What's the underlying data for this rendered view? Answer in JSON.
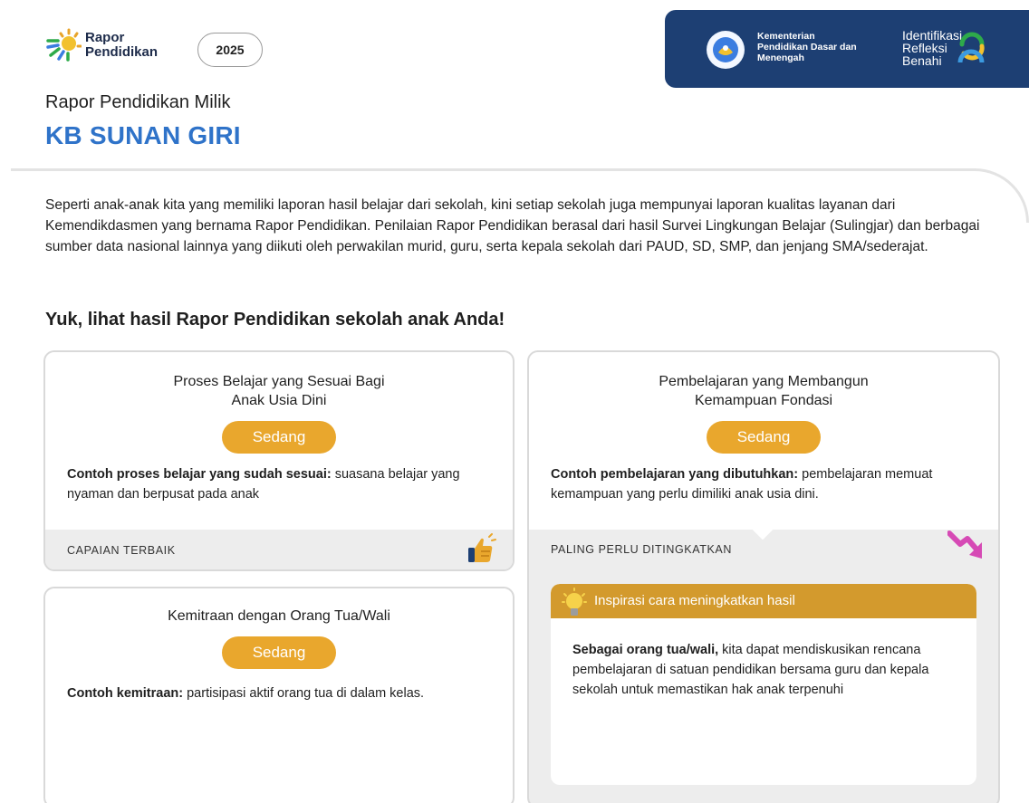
{
  "header": {
    "brand_line1": "Rapor",
    "brand_line2": "Pendidikan",
    "year": "2025",
    "ministry_line1": "Kementerian",
    "ministry_line2": "Pendidikan Dasar dan",
    "ministry_line3": "Menengah",
    "irb_line1": "Identifikasi",
    "irb_line2": "Refleksi",
    "irb_line3": "Benahi"
  },
  "page": {
    "subtitle": "Rapor Pendidikan Milik",
    "school_name": "KB SUNAN GIRI",
    "intro": "Seperti anak-anak kita yang memiliki laporan hasil belajar dari sekolah, kini setiap sekolah juga mempunyai laporan kualitas layanan dari Kemendikdasmen yang bernama Rapor Pendidikan. Penilaian Rapor Pendidikan berasal dari hasil Survei Lingkungan Belajar (Sulingjar) dan berbagai sumber data nasional lainnya yang diikuti oleh perwakilan murid, guru, serta kepala sekolah dari PAUD, SD, SMP, dan jenjang SMA/sederajat.",
    "section_title": "Yuk, lihat hasil Rapor Pendidikan sekolah anak Anda!"
  },
  "cards": [
    {
      "title_line1": "Proses Belajar yang Sesuai Bagi",
      "title_line2": "Anak Usia Dini",
      "level": "Sedang",
      "desc_bold": "Contoh proses belajar yang sudah sesuai:",
      "desc_text": " suasana belajar yang nyaman dan berpusat pada anak",
      "footer": "CAPAIAN TERBAIK"
    },
    {
      "title_line1": "Kemitraan dengan Orang Tua/Wali",
      "level": "Sedang",
      "desc_bold": "Contoh kemitraan:",
      "desc_text": " partisipasi aktif orang tua di dalam kelas."
    },
    {
      "title_line1": "Pembelajaran yang Membangun",
      "title_line2": "Kemampuan Fondasi",
      "level": "Sedang",
      "desc_bold": "Contoh pembelajaran yang dibutuhkan:",
      "desc_text": " pembelajaran memuat kemampuan yang perlu dimiliki anak usia dini.",
      "footer": "PALING PERLU DITINGKATKAN"
    }
  ],
  "inspiration": {
    "heading": "Inspirasi cara meningkatkan hasil",
    "body_bold": "Sebagai orang tua/wali,",
    "body_text": " kita dapat mendiskusikan rencana pembelajaran di satuan pendidikan bersama guru dan kepala sekolah untuk memastikan hak anak terpenuhi"
  },
  "colors": {
    "accent_blue": "#2f73c9",
    "banner_navy": "#1d3f73",
    "pill_orange": "#e9a72d",
    "inspiration_orange": "#d39a2d",
    "footer_gray": "#ededed"
  },
  "icons": [
    "rapor-pendidikan-logo-icon",
    "tut-wuri-handayani-emblem-icon",
    "irb-ring-icon",
    "thumbs-up-icon",
    "trend-down-arrow-icon",
    "lightbulb-icon"
  ]
}
